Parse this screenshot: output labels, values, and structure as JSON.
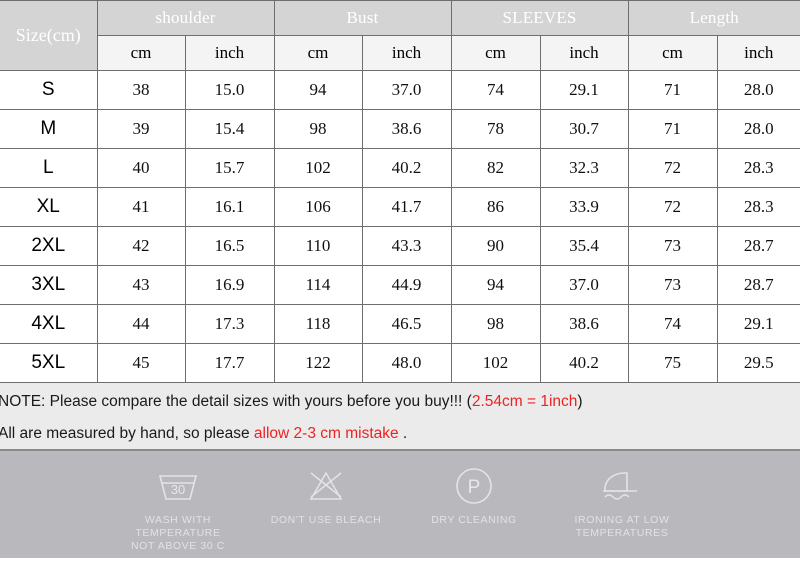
{
  "table": {
    "size_header": "Size(cm)",
    "groups": [
      "shoulder",
      "Bust",
      "SLEEVES",
      "Length"
    ],
    "units": [
      "cm",
      "inch",
      "cm",
      "inch",
      "cm",
      "inch",
      "cm",
      "inch"
    ],
    "rows": [
      {
        "size": "S",
        "values": [
          "38",
          "15.0",
          "94",
          "37.0",
          "74",
          "29.1",
          "71",
          "28.0"
        ]
      },
      {
        "size": "M",
        "values": [
          "39",
          "15.4",
          "98",
          "38.6",
          "78",
          "30.7",
          "71",
          "28.0"
        ]
      },
      {
        "size": "L",
        "values": [
          "40",
          "15.7",
          "102",
          "40.2",
          "82",
          "32.3",
          "72",
          "28.3"
        ]
      },
      {
        "size": "XL",
        "values": [
          "41",
          "16.1",
          "106",
          "41.7",
          "86",
          "33.9",
          "72",
          "28.3"
        ]
      },
      {
        "size": "2XL",
        "values": [
          "42",
          "16.5",
          "110",
          "43.3",
          "90",
          "35.4",
          "73",
          "28.7"
        ]
      },
      {
        "size": "3XL",
        "values": [
          "43",
          "16.9",
          "114",
          "44.9",
          "94",
          "37.0",
          "73",
          "28.7"
        ]
      },
      {
        "size": "4XL",
        "values": [
          "44",
          "17.3",
          "118",
          "46.5",
          "98",
          "38.6",
          "74",
          "29.1"
        ]
      },
      {
        "size": "5XL",
        "values": [
          "45",
          "17.7",
          "122",
          "48.0",
          "102",
          "40.2",
          "75",
          "29.5"
        ]
      }
    ]
  },
  "note": {
    "line1_prefix": "NOTE: Please compare the detail sizes with yours before you buy!!! (",
    "line1_red": "2.54cm = 1inch",
    "line1_suffix": ")",
    "line2_prefix": "All are measured by hand, so please ",
    "line2_red": "allow 2-3 cm mistake",
    "line2_suffix": " ."
  },
  "care": {
    "items": [
      {
        "icon": "wash-tub-30-icon",
        "badge": "30",
        "label": "WASH WITH TEMPERATURE\nNOT ABOVE 30 C"
      },
      {
        "icon": "no-bleach-triangle-icon",
        "badge": "",
        "label": "DON'T USE BLEACH"
      },
      {
        "icon": "dry-clean-p-circle-icon",
        "badge": "P",
        "label": "DRY CLEANING"
      },
      {
        "icon": "iron-low-temp-icon",
        "badge": "",
        "label": "IRONING AT LOW\nTEMPERATURES"
      }
    ]
  },
  "colors": {
    "header_grey": "#d4d4d4",
    "unit_band": "#f4f4f4",
    "note_bg": "#ebebeb",
    "care_bg": "#b9b9bd",
    "accent_red": "#ee2222",
    "border": "#6e6e6e"
  }
}
